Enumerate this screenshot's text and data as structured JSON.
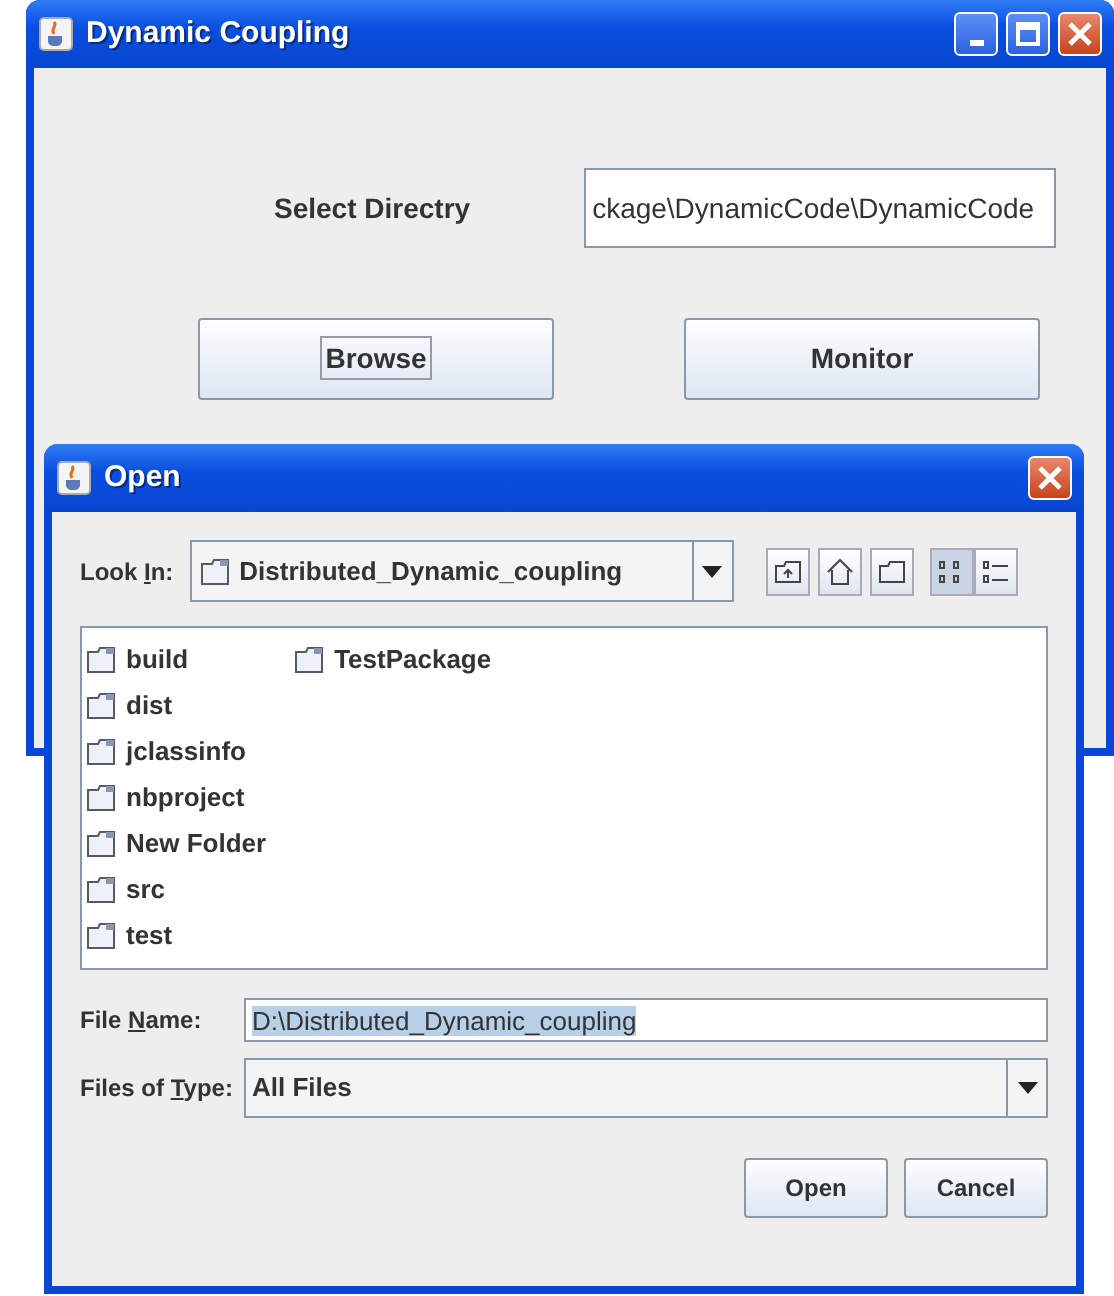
{
  "main_window": {
    "title": "Dynamic Coupling",
    "directory_label": "Select Directry",
    "directory_field": "ckage\\DynamicCode\\DynamicCode",
    "buttons": [
      {
        "label": "Browse",
        "focused": true
      },
      {
        "label": "Monitor",
        "focused": false
      }
    ]
  },
  "open_dialog": {
    "title": "Open",
    "look_in": {
      "label": [
        {
          "text": "Look ",
          "underlined": false
        },
        {
          "text": "I",
          "underlined": true
        },
        {
          "text": "n:",
          "underlined": false
        }
      ],
      "value": "Distributed_Dynamic_coupling"
    },
    "view_buttons": [
      {
        "kind": "list",
        "selected": true
      },
      {
        "kind": "details",
        "selected": false
      }
    ],
    "files": [
      {
        "name": "build"
      },
      {
        "name": "dist"
      },
      {
        "name": "jclassinfo"
      },
      {
        "name": "nbproject"
      },
      {
        "name": "New Folder"
      },
      {
        "name": "src"
      },
      {
        "name": "test"
      },
      {
        "name": "TestPackage"
      }
    ],
    "file_name": {
      "label": [
        {
          "text": "File ",
          "underlined": false
        },
        {
          "text": "N",
          "underlined": true
        },
        {
          "text": "ame:",
          "underlined": false
        }
      ],
      "value": "D:\\Distributed_Dynamic_coupling"
    },
    "files_of_type": {
      "label": [
        {
          "text": "Files of ",
          "underlined": false
        },
        {
          "text": "T",
          "underlined": true
        },
        {
          "text": "ype:",
          "underlined": false
        }
      ],
      "value": "All Files"
    },
    "buttons": [
      {
        "label": "Open"
      },
      {
        "label": "Cancel"
      }
    ]
  }
}
